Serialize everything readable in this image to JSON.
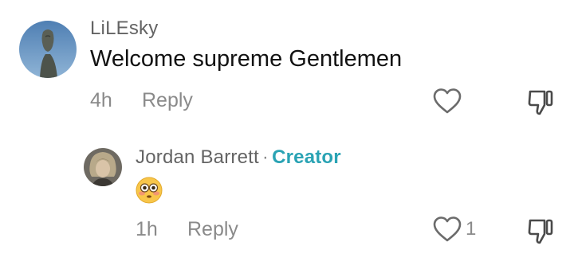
{
  "comments": [
    {
      "username": "LiLEsky",
      "text": "Welcome supreme Gentlemen",
      "time": "4h",
      "reply_label": "Reply",
      "avatar": "statue-avatar",
      "icons": {
        "like": "heart-outline-icon",
        "dislike": "thumbs-down-icon"
      }
    },
    {
      "username": "Jordan Barrett",
      "separator": "·",
      "badge": "Creator",
      "emoji": "flushed-face-emoji",
      "time": "1h",
      "reply_label": "Reply",
      "like_count": "1",
      "avatar": "portrait-avatar",
      "icons": {
        "like": "heart-outline-icon",
        "dislike": "thumbs-down-icon"
      }
    }
  ],
  "colors": {
    "username": "#646464",
    "meta": "#8a8a8a",
    "creator_badge": "#2aa3b4",
    "text": "#121212"
  }
}
